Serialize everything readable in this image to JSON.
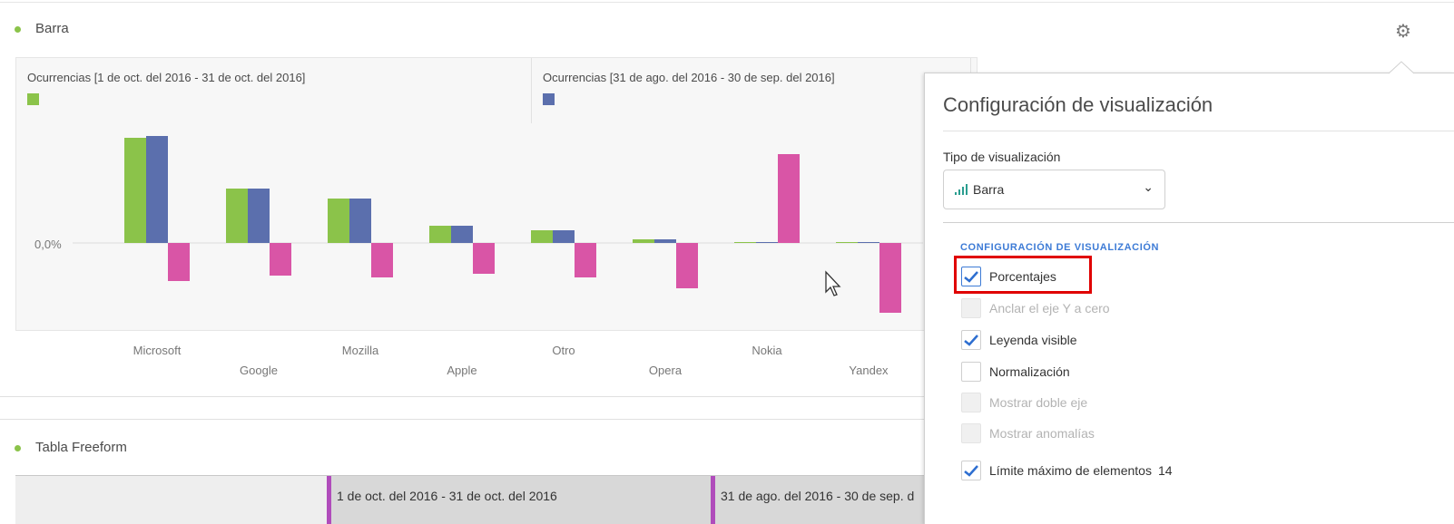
{
  "bar_panel": {
    "title": "Barra",
    "settings_icon": "gear-icon"
  },
  "chart_data": {
    "type": "bar",
    "title": "",
    "y_tick_labels": [
      "0,0%"
    ],
    "categories": [
      "Microsoft",
      "Google",
      "Mozilla",
      "Apple",
      "Otro",
      "Opera",
      "Nokia",
      "Yandex"
    ],
    "series": [
      {
        "name": "Ocurrencias [1 de oct. del 2016 - 31 de oct. del 2016]",
        "color": "#8bc34a",
        "values": [
          116,
          60,
          49,
          19,
          14,
          4,
          1,
          1
        ]
      },
      {
        "name": "Ocurrencias [31 de ago. del 2016 - 30 de sep. del 2016]",
        "color": "#5b6fad",
        "values": [
          118,
          60,
          49,
          19,
          14,
          4,
          1,
          1
        ]
      },
      {
        "name": "",
        "color": "#d955a6",
        "values": [
          -42,
          -36,
          -38,
          -34,
          -38,
          -50,
          98,
          -77
        ]
      }
    ],
    "legend": "top",
    "note_units": "relative, no scale printed other than 0,0%"
  },
  "table_panel": {
    "title": "Tabla Freeform",
    "columns": [
      "1 de oct. del 2016 - 31 de oct. del 2016",
      "31 de ago. del 2016 - 30 de sep. d"
    ]
  },
  "popover": {
    "title": "Configuración de visualización",
    "type_label": "Tipo de visualización",
    "type_value": "Barra",
    "section": "CONFIGURACIÓN DE VISUALIZACIÓN",
    "options": [
      {
        "label": "Porcentajes",
        "checked": true,
        "disabled": false,
        "highlighted": true
      },
      {
        "label": "Anclar el eje Y a cero",
        "checked": false,
        "disabled": true
      },
      {
        "label": "Leyenda visible",
        "checked": true,
        "disabled": false
      },
      {
        "label": "Normalización",
        "checked": false,
        "disabled": false
      },
      {
        "label": "Mostrar doble eje",
        "checked": false,
        "disabled": true
      },
      {
        "label": "Mostrar anomalías",
        "checked": false,
        "disabled": true
      },
      {
        "label": "Límite máximo de elementos",
        "checked": true,
        "disabled": false,
        "value": "14"
      }
    ]
  }
}
